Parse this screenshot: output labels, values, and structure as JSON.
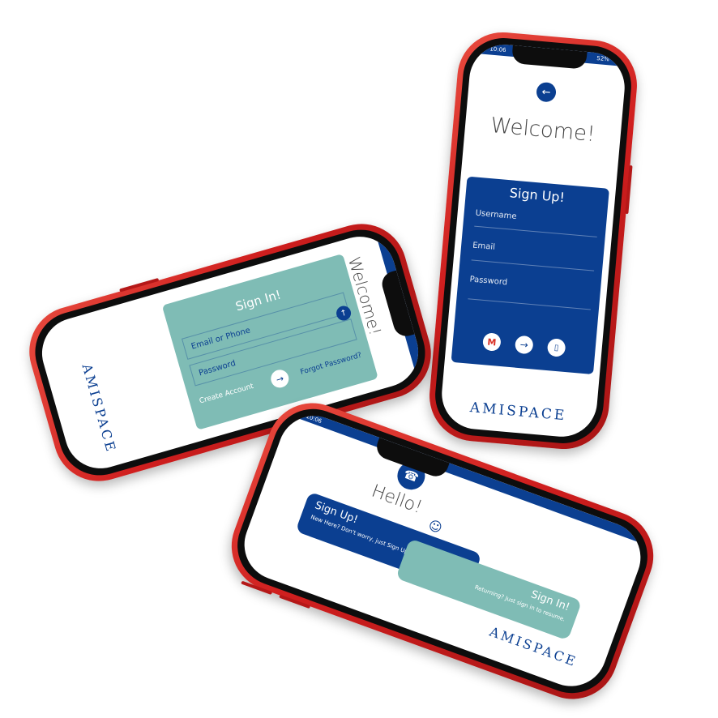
{
  "status": {
    "time": "10:06",
    "battery": "52%"
  },
  "brand": {
    "name": "AMISPACE"
  },
  "icons": {
    "back": "arrow-left-icon",
    "next": "arrow-right-icon",
    "gmail": "gmail-icon",
    "phone": "phone-icon",
    "user": "user-icon",
    "avatar": "avatar-icon"
  },
  "colors": {
    "primary": "#0b3f91",
    "teal": "#7fbcb5",
    "frame": "#d42020"
  },
  "signup_screen": {
    "title": "Welcome!",
    "card_title": "Sign Up!",
    "username_placeholder": "Username",
    "email_placeholder": "Email",
    "password_placeholder": "Password"
  },
  "signin_screen": {
    "title": "Welcome!",
    "card_title": "Sign In!",
    "email_placeholder": "Email or Phone",
    "password_placeholder": "Password",
    "create_account": "Create Account",
    "forgot_password": "Forgot Password?"
  },
  "home_screen": {
    "greeting": "Hello!",
    "signup_title": "Sign Up!",
    "signup_subtitle": "New Here? Don't worry, just Sign Up.",
    "signin_title": "Sign In!",
    "signin_subtitle": "Returning? Just sign in to resume."
  }
}
